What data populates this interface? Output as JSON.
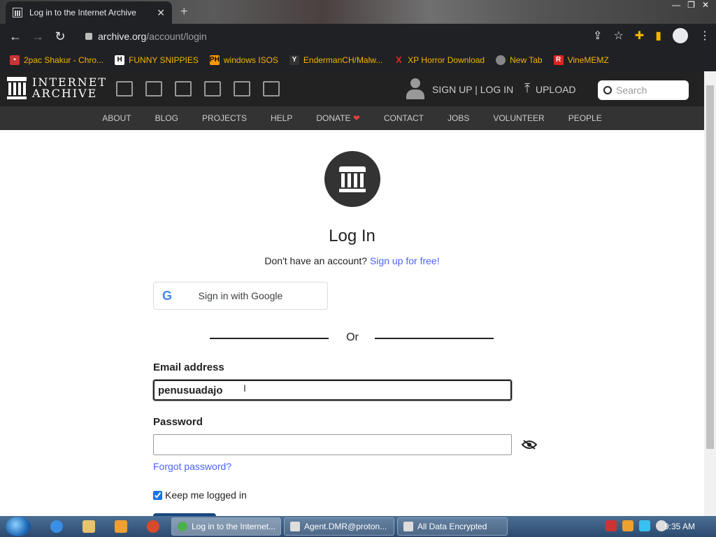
{
  "browser": {
    "tab_title": "Log in to the Internet Archive",
    "url_host": "archive.org",
    "url_path": "/account/login",
    "bookmarks": [
      {
        "label": "2pac Shakur - Chro...",
        "icon": "tupac-favicon"
      },
      {
        "label": "FUNNY SNIPPIES",
        "icon": "H"
      },
      {
        "label": "windows ISOS",
        "icon": "PH"
      },
      {
        "label": "EndermanCH/Malw...",
        "icon": "Y"
      },
      {
        "label": "XP Horror Download",
        "icon": "X"
      },
      {
        "label": "New Tab",
        "icon": "globe"
      },
      {
        "label": "VineMEMZ",
        "icon": "R"
      }
    ]
  },
  "header": {
    "logo_line1": "INTERNET",
    "logo_line2": "ARCHIVE",
    "auth_links": "SIGN UP | LOG IN",
    "upload": "UPLOAD",
    "search_placeholder": "Search",
    "nav": [
      "ABOUT",
      "BLOG",
      "PROJECTS",
      "HELP",
      "DONATE",
      "CONTACT",
      "JOBS",
      "VOLUNTEER",
      "PEOPLE"
    ],
    "donate_heart": "❤"
  },
  "login": {
    "title": "Log In",
    "no_account": "Don't have an account?",
    "signup_link": "Sign up for free!",
    "google_button": "Sign in with Google",
    "or": "Or",
    "email_label": "Email address",
    "email_value": "penusuadajo",
    "password_label": "Password",
    "password_value": "",
    "forgot": "Forgot password?",
    "keep_logged_in": "Keep me logged in",
    "keep_checked": true
  },
  "taskbar": {
    "tasks": [
      {
        "label": "Log in to the Internet...",
        "active": true
      },
      {
        "label": "Agent.DMR@proton...",
        "active": false
      },
      {
        "label": "All Data Encrypted",
        "active": false
      }
    ],
    "clock": "9:35 AM"
  }
}
